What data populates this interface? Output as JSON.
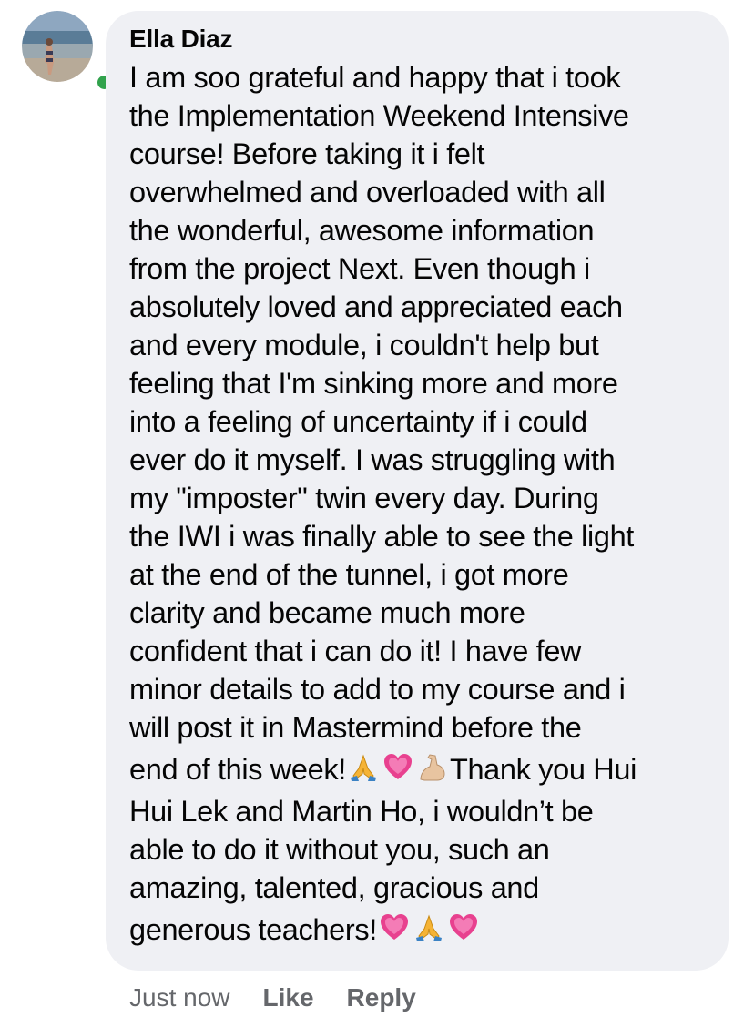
{
  "comment": {
    "author": "Ella Diaz",
    "avatar": {
      "icon": "user-photo-avatar",
      "online": true,
      "online_color": "#31a24c"
    },
    "lines": [
      "I am soo grateful and happy that i took",
      "the Implementation Weekend Intensive",
      "course! Before taking it i felt",
      "overwhelmed and overloaded with all",
      "the wonderful, awesome information",
      "from the project Next. Even though i",
      "absolutely loved and appreciated each",
      "and every module, i couldn't help but",
      "feeling that I'm sinking more and more",
      "into a feeling of uncertainty if i could",
      "ever do it myself. I was struggling with",
      "my \"imposter\" twin every day. During",
      "the IWI i was finally able to see the light",
      "at the end of the tunnel, i got more",
      "clarity and became much more",
      "confident that i can do it! I have few",
      "minor details to add to my course and i",
      "will post it in Mastermind before the"
    ],
    "line_end_a": "end of this week!",
    "line_end_b": "Thank you Hui",
    "lines_after": [
      "Hui Lek and Martin Ho, i wouldn’t be",
      "able to do it without you, such an",
      "amazing, talented, gracious and"
    ],
    "line_last": "generous teachers!",
    "emojis": {
      "week_end": [
        "folded-hands-emoji",
        "growing-heart-emoji",
        "flexed-biceps-emoji"
      ],
      "last": [
        "growing-heart-emoji",
        "folded-hands-emoji",
        "growing-heart-emoji"
      ]
    }
  },
  "actions": {
    "timestamp": "Just now",
    "like": "Like",
    "reply": "Reply"
  },
  "colors": {
    "bubble": "#eff0f4",
    "text": "#050505",
    "meta": "#65676b"
  }
}
